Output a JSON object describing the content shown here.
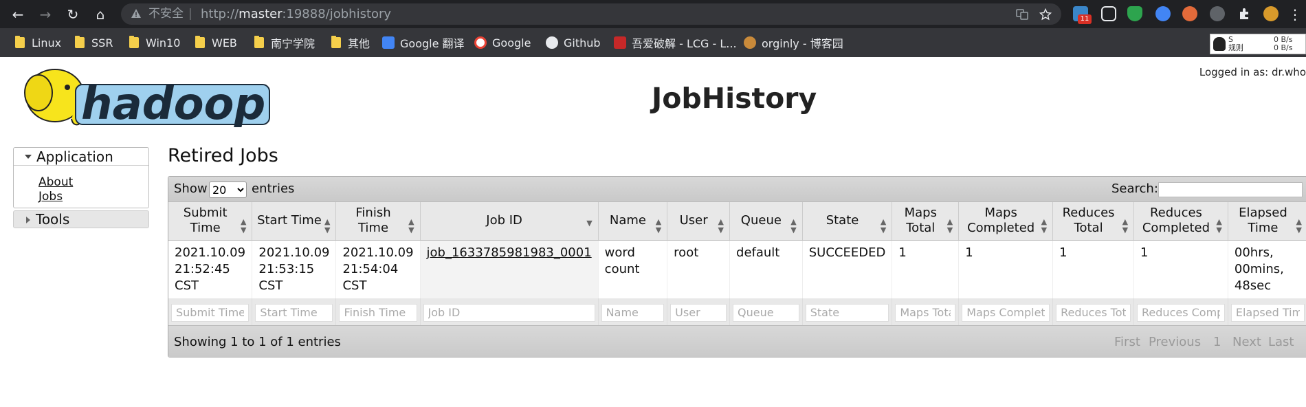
{
  "browser": {
    "insecure_label": "不安全",
    "separator": "|",
    "url_prefix": "http://",
    "url_host": "master",
    "url_rest": ":19888/jobhistory",
    "ext_badge": "11"
  },
  "bookmarks": [
    {
      "label": "Linux"
    },
    {
      "label": "SSR"
    },
    {
      "label": "Win10"
    },
    {
      "label": "WEB"
    },
    {
      "label": "南宁学院"
    },
    {
      "label": "其他"
    },
    {
      "label": "Google 翻译"
    },
    {
      "label": "Google"
    },
    {
      "label": "Github"
    },
    {
      "label": "吾爱破解 - LCG - L..."
    },
    {
      "label": "orginly - 博客园"
    }
  ],
  "traffic": {
    "up_label": "S",
    "rule_label": "规则",
    "up_speed": "0 B/s",
    "down_speed": "0 B/s"
  },
  "page": {
    "logged_in": "Logged in as: dr.who",
    "title": "JobHistory",
    "logo_text": "hadoop"
  },
  "sidebar": {
    "application": "Application",
    "about": "About",
    "jobs": "Jobs",
    "tools": "Tools"
  },
  "section_title": "Retired Jobs",
  "table_controls": {
    "show": "Show",
    "page_size": "20",
    "entries": "entries",
    "search_label": "Search:"
  },
  "columns": [
    {
      "line1": "Submit",
      "line2": "Time"
    },
    {
      "line1": "Start Time",
      "line2": ""
    },
    {
      "line1": "Finish Time",
      "line2": ""
    },
    {
      "line1": "Job ID",
      "line2": ""
    },
    {
      "line1": "Name",
      "line2": ""
    },
    {
      "line1": "User",
      "line2": ""
    },
    {
      "line1": "Queue",
      "line2": ""
    },
    {
      "line1": "State",
      "line2": ""
    },
    {
      "line1": "Maps",
      "line2": "Total"
    },
    {
      "line1": "Maps",
      "line2": "Completed"
    },
    {
      "line1": "Reduces",
      "line2": "Total"
    },
    {
      "line1": "Reduces",
      "line2": "Completed"
    },
    {
      "line1": "Elapsed",
      "line2": "Time"
    }
  ],
  "rows": [
    {
      "submit": [
        "2021.10.09",
        "21:52:45",
        "CST"
      ],
      "start": [
        "2021.10.09",
        "21:53:15",
        "CST"
      ],
      "finish": [
        "2021.10.09",
        "21:54:04",
        "CST"
      ],
      "job_id": "job_1633785981983_0001",
      "name": [
        "word",
        "count"
      ],
      "user": "root",
      "queue": "default",
      "state": "SUCCEEDED",
      "maps_total": "1",
      "maps_completed": "1",
      "reduces_total": "1",
      "reduces_completed": "1",
      "elapsed": [
        "00hrs,",
        "00mins,",
        "48sec"
      ]
    }
  ],
  "filters": [
    "Submit Time",
    "Start Time",
    "Finish Time",
    "Job ID",
    "Name",
    "User",
    "Queue",
    "State",
    "Maps Total",
    "Maps Completed",
    "Reduces Total",
    "Reduces Completed",
    "Elapsed Time"
  ],
  "footer": {
    "info": "Showing 1 to 1 of 1 entries",
    "first": "First",
    "previous": "Previous",
    "page": "1",
    "next": "Next",
    "last": "Last"
  },
  "colors": {
    "chrome_bg": "#202124",
    "bookmark_bg": "#35363a",
    "folder": "#f5cf4b",
    "table_header": "#e8e8e8"
  }
}
